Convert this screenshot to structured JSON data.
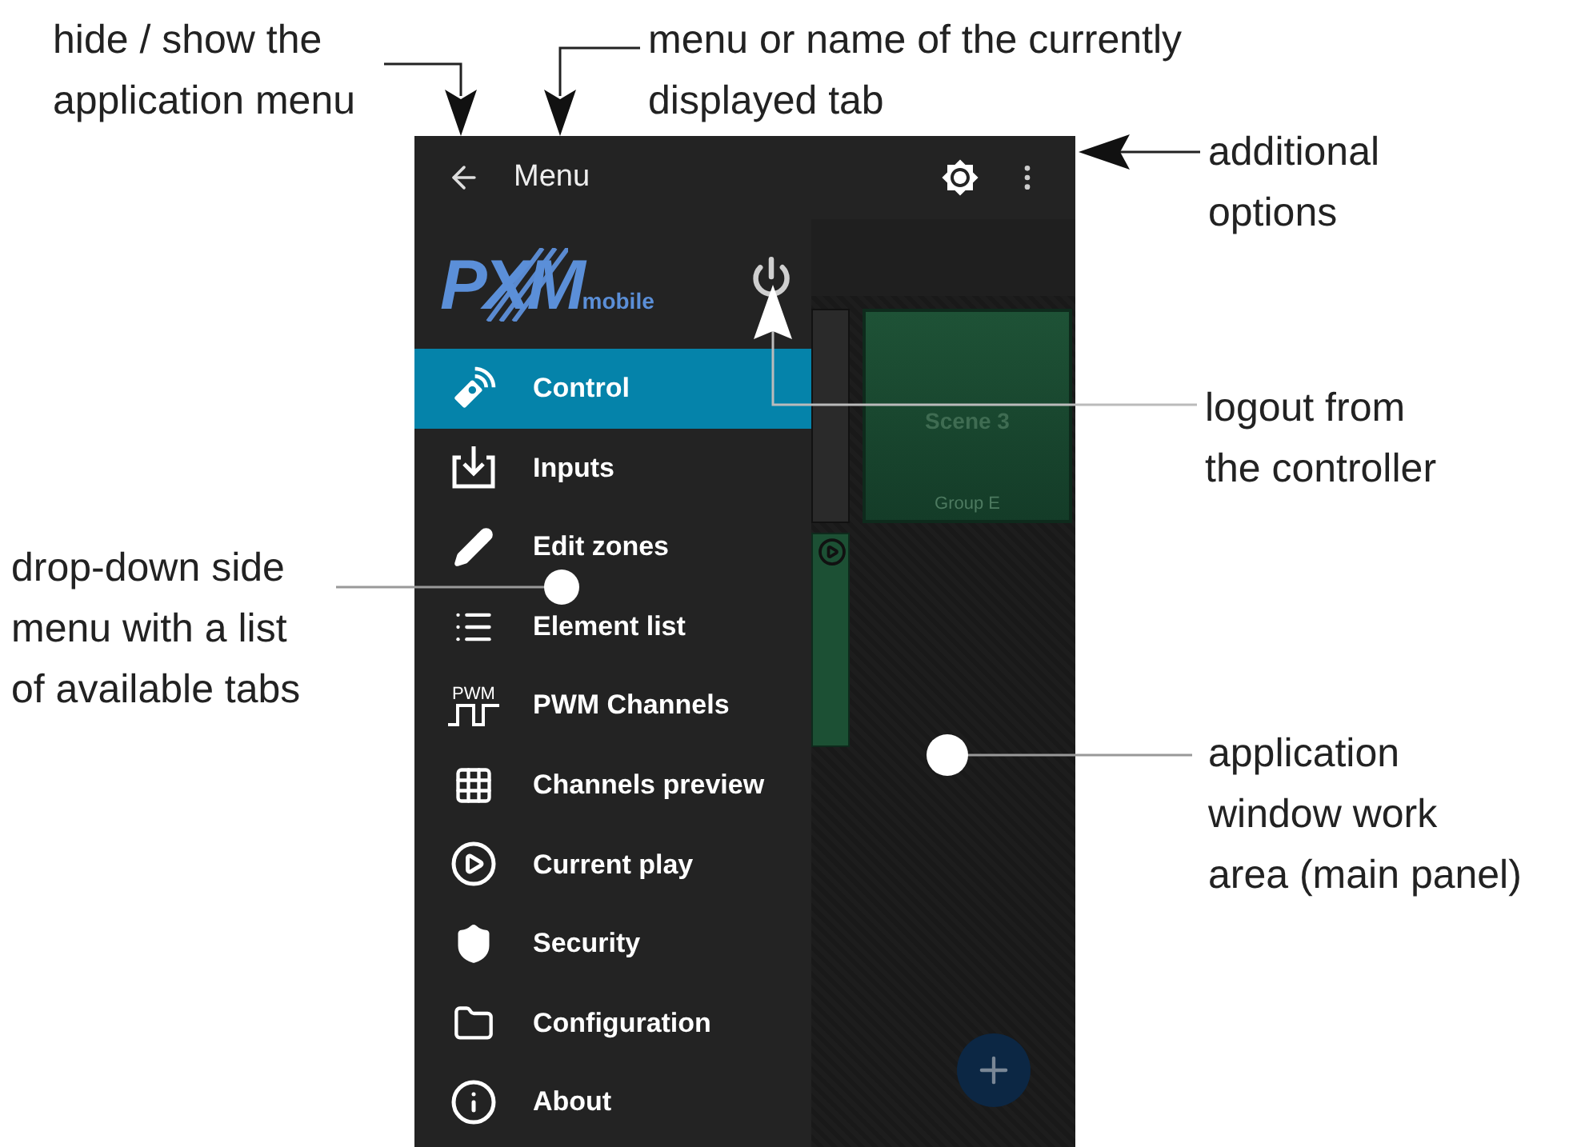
{
  "annotations": [
    {
      "text": "hide / show the\napplication menu"
    },
    {
      "text": "menu or name of the currently\ndisplayed tab"
    },
    {
      "text": "additional\noptions"
    },
    {
      "text": "logout from\nthe controller"
    },
    {
      "text": "drop-down side\nmenu with a list\nof available tabs"
    },
    {
      "text": "application\nwindow work\narea (main panel)"
    }
  ],
  "app_bar": {
    "title": "Menu"
  },
  "logo": {
    "text": "PXM",
    "sub": "mobile"
  },
  "drawer": {
    "items": [
      {
        "label": "Control",
        "selected": true
      },
      {
        "label": "Inputs",
        "selected": false
      },
      {
        "label": "Edit zones",
        "selected": false
      },
      {
        "label": "Element list",
        "selected": false
      },
      {
        "label": "PWM Channels",
        "selected": false,
        "icon_text": "PWM"
      },
      {
        "label": "Channels preview",
        "selected": false
      },
      {
        "label": "Current play",
        "selected": false
      },
      {
        "label": "Security",
        "selected": false
      },
      {
        "label": "Configuration",
        "selected": false
      },
      {
        "label": "About",
        "selected": false
      }
    ]
  },
  "main": {
    "tiles": [
      {
        "title": "Scene 3",
        "group": "Group E"
      }
    ]
  }
}
